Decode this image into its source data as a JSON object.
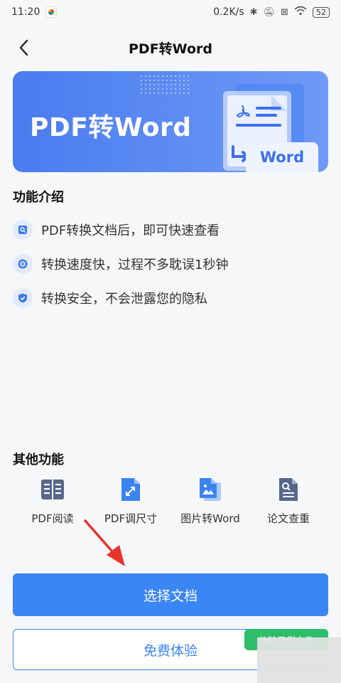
{
  "status_bar": {
    "time": "11:20",
    "speed": "0.2K/s",
    "battery": "52"
  },
  "nav": {
    "title": "PDF转Word"
  },
  "banner": {
    "title": "PDF转Word",
    "badge": "Word"
  },
  "intro": {
    "heading": "功能介绍",
    "items": [
      {
        "text": "PDF转换文档后，即可快速查看",
        "icon": "search-doc-icon"
      },
      {
        "text": "转换速度快，过程不多耽误1秒钟",
        "icon": "speed-icon"
      },
      {
        "text": "转换安全，不会泄露您的隐私",
        "icon": "shield-icon"
      }
    ]
  },
  "other": {
    "heading": "其他功能",
    "tools": [
      {
        "label": "PDF阅读",
        "icon": "book-icon"
      },
      {
        "label": "PDF调尺寸",
        "icon": "resize-doc-icon"
      },
      {
        "label": "图片转Word",
        "icon": "image-to-word-icon"
      },
      {
        "label": "论文查重",
        "icon": "doc-check-icon"
      }
    ]
  },
  "actions": {
    "primary": "选择文档",
    "secondary": "免费体验",
    "badge": "体验示例文件"
  },
  "colors": {
    "primary": "#3a86f5",
    "banner": "#4a7cf0",
    "badge_green": "#2fbd6b",
    "arrow_red": "#e8342c"
  }
}
